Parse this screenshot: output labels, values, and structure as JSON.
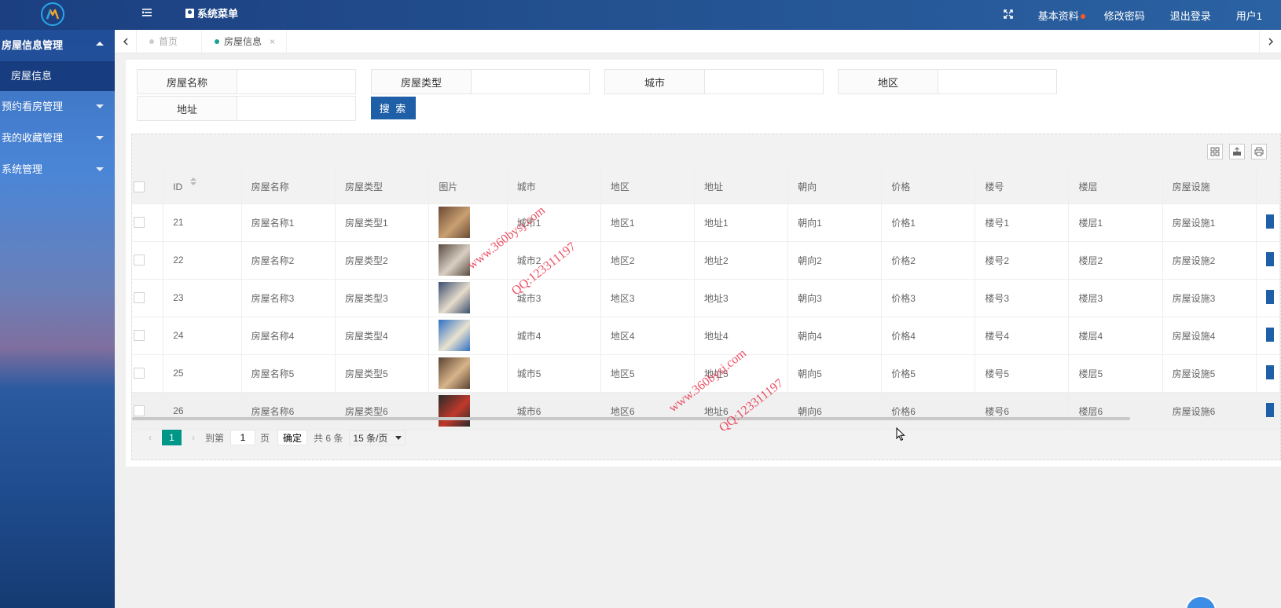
{
  "header": {
    "menu_title": "系统菜单",
    "links": [
      "基本资料",
      "修改密码",
      "退出登录",
      "用户1"
    ]
  },
  "sidebar": {
    "groups": [
      {
        "label": "房屋信息管理",
        "open": true,
        "items": [
          "房屋信息"
        ]
      },
      {
        "label": "预约看房管理",
        "open": false
      },
      {
        "label": "我的收藏管理",
        "open": false
      },
      {
        "label": "系统管理",
        "open": false
      }
    ]
  },
  "tabs": {
    "home": "首页",
    "current": "房屋信息",
    "close": "×"
  },
  "search": {
    "name_label": "房屋名称",
    "type_label": "房屋类型",
    "city_label": "城市",
    "area_label": "地区",
    "address_label": "地址",
    "button": "搜 索"
  },
  "table": {
    "headers": [
      "ID",
      "房屋名称",
      "房屋类型",
      "图片",
      "城市",
      "地区",
      "地址",
      "朝向",
      "价格",
      "楼号",
      "楼层",
      "房屋设施"
    ],
    "rows": [
      [
        "21",
        "房屋名称1",
        "房屋类型1",
        "",
        "城市1",
        "地区1",
        "地址1",
        "朝向1",
        "价格1",
        "楼号1",
        "楼层1",
        "房屋设施1"
      ],
      [
        "22",
        "房屋名称2",
        "房屋类型2",
        "",
        "城市2",
        "地区2",
        "地址2",
        "朝向2",
        "价格2",
        "楼号2",
        "楼层2",
        "房屋设施2"
      ],
      [
        "23",
        "房屋名称3",
        "房屋类型3",
        "",
        "城市3",
        "地区3",
        "地址3",
        "朝向3",
        "价格3",
        "楼号3",
        "楼层3",
        "房屋设施3"
      ],
      [
        "24",
        "房屋名称4",
        "房屋类型4",
        "",
        "城市4",
        "地区4",
        "地址4",
        "朝向4",
        "价格4",
        "楼号4",
        "楼层4",
        "房屋设施4"
      ],
      [
        "25",
        "房屋名称5",
        "房屋类型5",
        "",
        "城市5",
        "地区5",
        "地址5",
        "朝向5",
        "价格5",
        "楼号5",
        "楼层5",
        "房屋设施5"
      ],
      [
        "26",
        "房屋名称6",
        "房屋类型6",
        "",
        "城市6",
        "地区6",
        "地址6",
        "朝向6",
        "价格6",
        "楼号6",
        "楼层6",
        "房屋设施6"
      ]
    ],
    "thumb_colors": [
      [
        "#6b4a35",
        "#c9a071"
      ],
      [
        "#5a4b40",
        "#d8cfc2"
      ],
      [
        "#3b4d6e",
        "#e6dccb"
      ],
      [
        "#2f6fc4",
        "#e9e2cf"
      ],
      [
        "#5b4232",
        "#d7b48a"
      ],
      [
        "#2a2a2a",
        "#c0392b"
      ]
    ]
  },
  "pager": {
    "current": "1",
    "goto_label": "到第",
    "goto_value": "1",
    "page_unit": "页",
    "confirm": "确定",
    "total": "共 6 条",
    "per_page": "15 条/页"
  },
  "watermarks": [
    "www.360bysj.com",
    "QQ:123311197",
    "www.360bysj.com",
    "QQ:123311197"
  ],
  "colors": {
    "header_bg": "#23508f",
    "primary_button": "#1f5fa8",
    "pager_active": "#009688",
    "watermark": "#e8334a"
  }
}
